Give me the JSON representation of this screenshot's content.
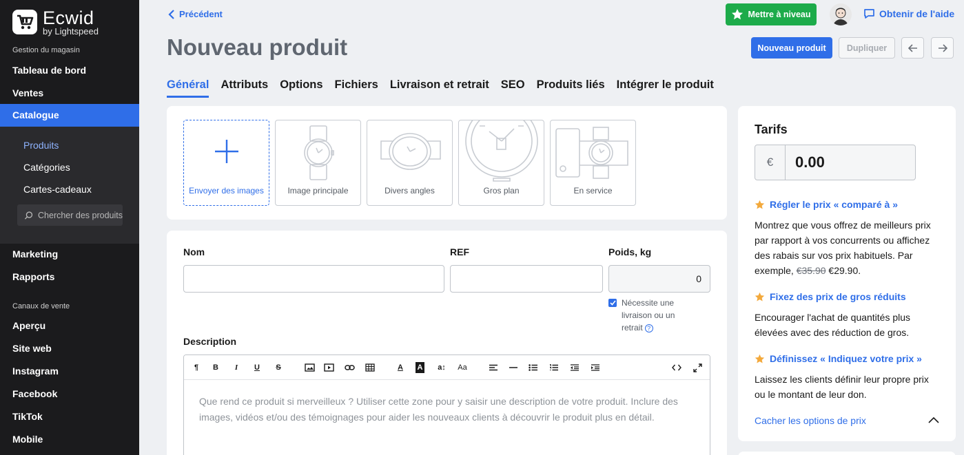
{
  "brand": {
    "name": "Ecwid",
    "sub": "by Lightspeed"
  },
  "sidebar": {
    "group_store": "Gestion du magasin",
    "items_top": [
      {
        "label": "Tableau de bord"
      },
      {
        "label": "Ventes"
      },
      {
        "label": "Catalogue",
        "active": true
      }
    ],
    "sub_items": [
      {
        "label": "Produits",
        "active": true
      },
      {
        "label": "Catégories"
      },
      {
        "label": "Cartes-cadeaux"
      }
    ],
    "search_placeholder": "Chercher des produits",
    "items_mid": [
      {
        "label": "Marketing"
      },
      {
        "label": "Rapports"
      }
    ],
    "group_channels": "Canaux de vente",
    "items_channels": [
      {
        "label": "Aperçu"
      },
      {
        "label": "Site web"
      },
      {
        "label": "Instagram"
      },
      {
        "label": "Facebook"
      },
      {
        "label": "TikTok"
      },
      {
        "label": "Mobile"
      }
    ]
  },
  "header": {
    "back_label": "Précédent",
    "title": "Nouveau produit",
    "upgrade_label": "Mettre à niveau",
    "help_label": "Obtenir de l'aide",
    "new_product_label": "Nouveau produit",
    "duplicate_label": "Dupliquer"
  },
  "tabs": [
    {
      "label": "Général",
      "active": true
    },
    {
      "label": "Attributs"
    },
    {
      "label": "Options"
    },
    {
      "label": "Fichiers"
    },
    {
      "label": "Livraison et retrait"
    },
    {
      "label": "SEO"
    },
    {
      "label": "Produits liés"
    },
    {
      "label": "Intégrer le produit"
    }
  ],
  "images": {
    "upload_label": "Envoyer des images",
    "tiles": [
      "Image principale",
      "Divers angles",
      "Gros plan",
      "En service"
    ]
  },
  "form": {
    "name_label": "Nom",
    "name_value": "",
    "sku_label": "REF",
    "sku_value": "",
    "weight_label": "Poids, kg",
    "weight_value": "0",
    "shipping_checkbox_label": "Nécessite une livraison ou un retrait",
    "shipping_checked": true,
    "description_label": "Description",
    "description_placeholder": "Que rend ce produit si merveilleux ? Utiliser cette zone pour y saisir une description de votre produit. Inclure des images, vidéos et/ou des témoignages pour aider les nouveaux clients à découvrir le produit plus en détail."
  },
  "pricing": {
    "title": "Tarifs",
    "currency": "€",
    "price": "0.00",
    "compare_title": "Régler le prix « comparé à »",
    "compare_desc_1": "Montrez que vous offrez de meilleurs prix par rapport à vos concurrents ou affichez des rabais sur vos prix habituels. Par exemple,",
    "compare_old_price": "€35.90",
    "compare_new_price": "€29.90.",
    "bulk_title": "Fixez des prix de gros réduits",
    "bulk_desc": "Encourager l'achat de quantités plus élevées avec des réduction de gros.",
    "pwyw_title": "Définissez « Indiquez votre prix »",
    "pwyw_desc": "Laissez les clients définir leur propre prix ou le montant de leur don.",
    "hide_options_label": "Cacher les options de prix"
  },
  "colors": {
    "accent": "#2f6ee8",
    "sidebar": "#1b1b1d",
    "upgrade": "#1dab4a",
    "star": "#f3a93c"
  }
}
